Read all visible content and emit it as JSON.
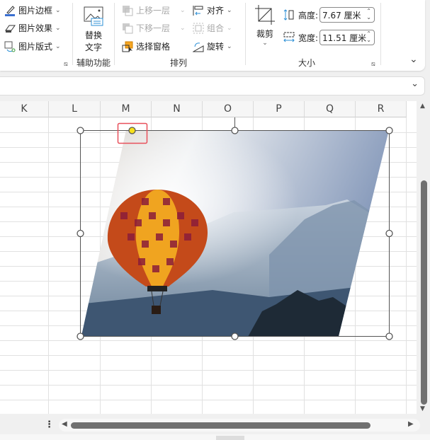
{
  "ribbon": {
    "picture_border": "图片边框",
    "picture_effects": "图片效果",
    "picture_layout": "图片版式",
    "alt_text_line1": "替换",
    "alt_text_line2": "文字",
    "accessibility_group": "辅助功能",
    "bring_forward": "上移一层",
    "send_backward": "下移一层",
    "selection_pane": "选择窗格",
    "align": "对齐",
    "group": "组合",
    "rotate": "旋转",
    "arrange_group": "排列",
    "crop": "裁剪",
    "height_label": "高度:",
    "height_value": "7.67 厘米",
    "width_label": "宽度:",
    "width_value": "11.51 厘米",
    "size_group": "大小"
  },
  "sheet": {
    "columns": [
      "K",
      "L",
      "M",
      "N",
      "O",
      "P",
      "Q",
      "R"
    ]
  },
  "colors": {
    "accent": "#e8505b",
    "handle_yellow": "#f7e01b"
  }
}
